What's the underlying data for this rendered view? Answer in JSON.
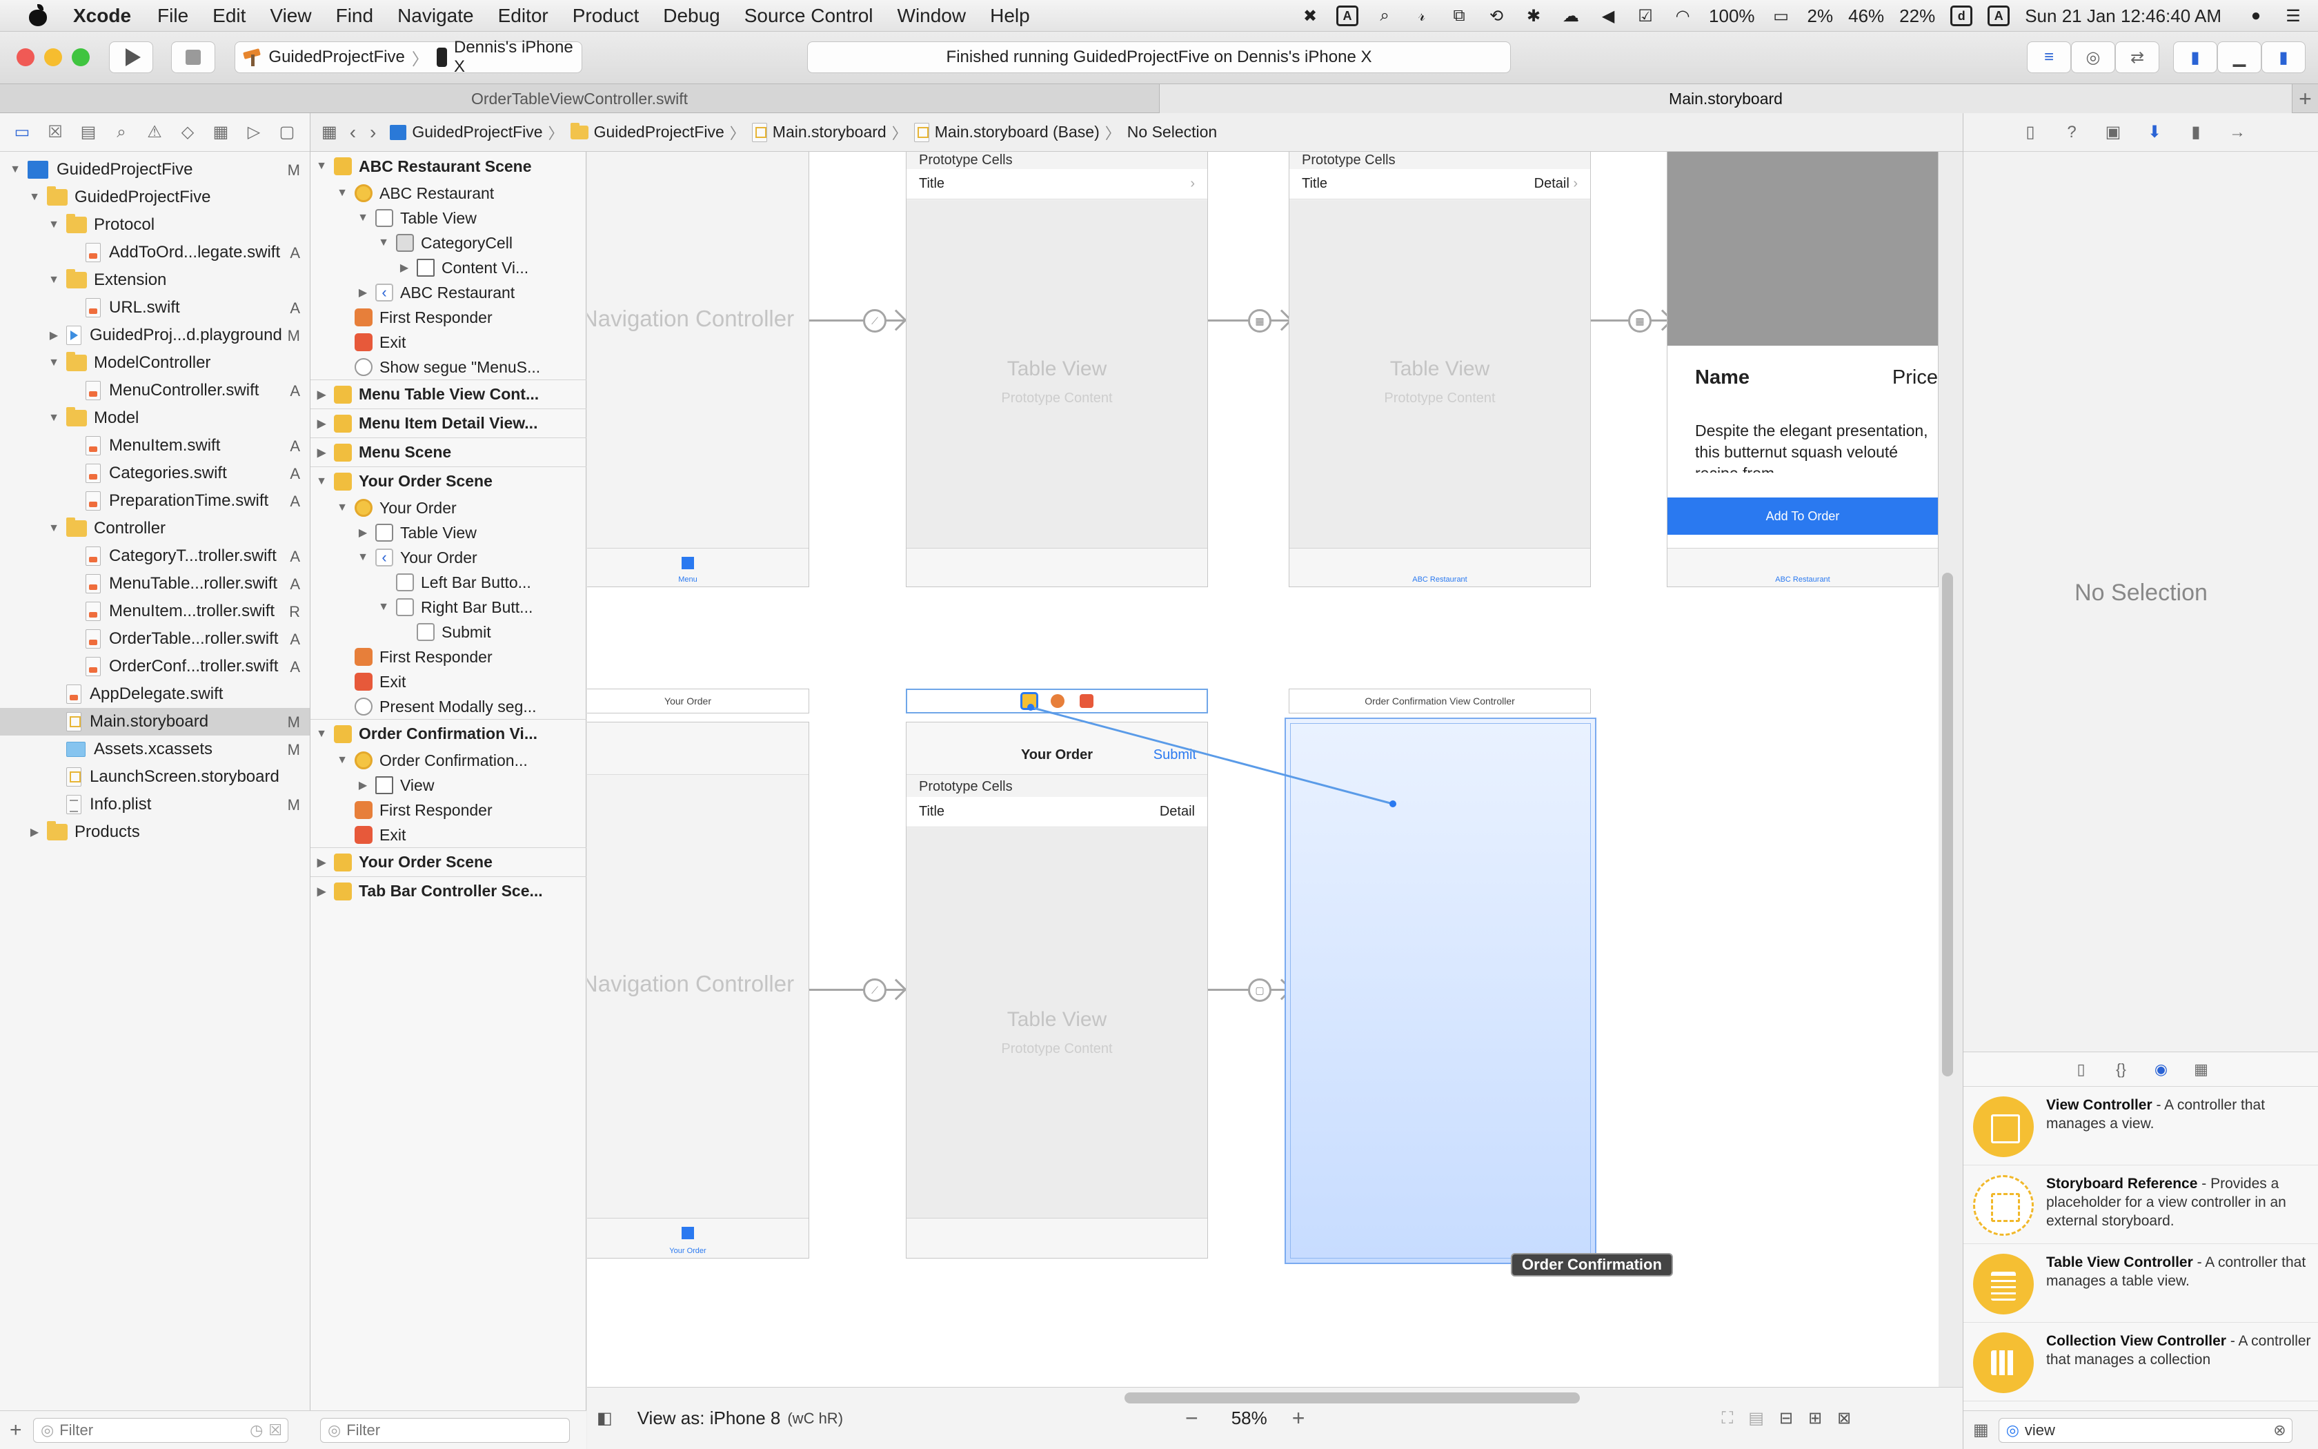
{
  "menubar": {
    "items": [
      "Xcode",
      "File",
      "Edit",
      "View",
      "Find",
      "Navigate",
      "Editor",
      "Product",
      "Debug",
      "Source Control",
      "Window",
      "Help"
    ],
    "status": {
      "battery1": "2%",
      "battery2": "46%",
      "battery3": "22%",
      "wifi_battery": "100%",
      "datetime": "Sun 21 Jan  12:46:40 AM",
      "mem_letter": "d",
      "input_letter": "A"
    }
  },
  "toolbar": {
    "scheme": "GuidedProjectFive",
    "device": "Dennis's iPhone X",
    "activity": "Finished running GuidedProjectFive on Dennis's iPhone X"
  },
  "tabs": [
    {
      "label": "OrderTableViewController.swift",
      "active": false
    },
    {
      "label": "Main.storyboard",
      "active": true
    }
  ],
  "navigator": {
    "items": [
      {
        "label": "GuidedProjectFive",
        "badge": "M",
        "indent": 0,
        "icon": "proj",
        "open": true
      },
      {
        "label": "GuidedProjectFive",
        "badge": "",
        "indent": 1,
        "icon": "folder",
        "open": true
      },
      {
        "label": "Protocol",
        "badge": "",
        "indent": 2,
        "icon": "folder",
        "open": true
      },
      {
        "label": "AddToOrd...legate.swift",
        "badge": "A",
        "indent": 3,
        "icon": "swift"
      },
      {
        "label": "Extension",
        "badge": "",
        "indent": 2,
        "icon": "folder",
        "open": true
      },
      {
        "label": "URL.swift",
        "badge": "A",
        "indent": 3,
        "icon": "swift"
      },
      {
        "label": "GuidedProj...d.playground",
        "badge": "M",
        "indent": 2,
        "icon": "play",
        "open": false
      },
      {
        "label": "ModelController",
        "badge": "",
        "indent": 2,
        "icon": "folder",
        "open": true
      },
      {
        "label": "MenuController.swift",
        "badge": "A",
        "indent": 3,
        "icon": "swift"
      },
      {
        "label": "Model",
        "badge": "",
        "indent": 2,
        "icon": "folder",
        "open": true
      },
      {
        "label": "MenuItem.swift",
        "badge": "A",
        "indent": 3,
        "icon": "swift"
      },
      {
        "label": "Categories.swift",
        "badge": "A",
        "indent": 3,
        "icon": "swift"
      },
      {
        "label": "PreparationTime.swift",
        "badge": "A",
        "indent": 3,
        "icon": "swift"
      },
      {
        "label": "Controller",
        "badge": "",
        "indent": 2,
        "icon": "folder",
        "open": true
      },
      {
        "label": "CategoryT...troller.swift",
        "badge": "A",
        "indent": 3,
        "icon": "swift"
      },
      {
        "label": "MenuTable...roller.swift",
        "badge": "A",
        "indent": 3,
        "icon": "swift"
      },
      {
        "label": "MenuItem...troller.swift",
        "badge": "R",
        "indent": 3,
        "icon": "swift"
      },
      {
        "label": "OrderTable...roller.swift",
        "badge": "A",
        "indent": 3,
        "icon": "swift"
      },
      {
        "label": "OrderConf...troller.swift",
        "badge": "A",
        "indent": 3,
        "icon": "swift"
      },
      {
        "label": "AppDelegate.swift",
        "badge": "",
        "indent": 2,
        "icon": "swift"
      },
      {
        "label": "Main.storyboard",
        "badge": "M",
        "indent": 2,
        "icon": "sb",
        "selected": true
      },
      {
        "label": "Assets.xcassets",
        "badge": "M",
        "indent": 2,
        "icon": "xcassets"
      },
      {
        "label": "LaunchScreen.storyboard",
        "badge": "",
        "indent": 2,
        "icon": "sb"
      },
      {
        "label": "Info.plist",
        "badge": "M",
        "indent": 2,
        "icon": "plist"
      },
      {
        "label": "Products",
        "badge": "",
        "indent": 1,
        "icon": "folder",
        "open": false
      }
    ],
    "filter_placeholder": "Filter"
  },
  "breadcrumb": [
    "GuidedProjectFive",
    "GuidedProjectFive",
    "Main.storyboard",
    "Main.storyboard (Base)",
    "No Selection"
  ],
  "outline": {
    "items": [
      {
        "label": "ABC Restaurant Scene",
        "indent": 0,
        "icon": "scene",
        "scene": true,
        "disc": "open"
      },
      {
        "label": "ABC Restaurant",
        "indent": 1,
        "icon": "vc",
        "disc": "open"
      },
      {
        "label": "Table View",
        "indent": 2,
        "icon": "tv",
        "disc": "open"
      },
      {
        "label": "CategoryCell",
        "indent": 3,
        "icon": "cell",
        "disc": "open"
      },
      {
        "label": "Content Vi...",
        "indent": 4,
        "icon": "view",
        "disc": "closed"
      },
      {
        "label": "ABC Restaurant",
        "indent": 2,
        "icon": "nav",
        "disc": "closed"
      },
      {
        "label": "First Responder",
        "indent": 1,
        "icon": "resp"
      },
      {
        "label": "Exit",
        "indent": 1,
        "icon": "exit"
      },
      {
        "label": "Show segue \"MenuS...",
        "indent": 1,
        "icon": "segue"
      },
      {
        "label": "Menu Table View Cont...",
        "indent": 0,
        "icon": "scene",
        "scene": true,
        "disc": "closed",
        "sep": true
      },
      {
        "label": "Menu Item Detail View...",
        "indent": 0,
        "icon": "scene",
        "scene": true,
        "disc": "closed",
        "sep": true
      },
      {
        "label": "Menu Scene",
        "indent": 0,
        "icon": "scene",
        "scene": true,
        "disc": "closed",
        "sep": true
      },
      {
        "label": "Your Order Scene",
        "indent": 0,
        "icon": "scene",
        "scene": true,
        "disc": "open",
        "sep": true
      },
      {
        "label": "Your Order",
        "indent": 1,
        "icon": "vc",
        "disc": "open"
      },
      {
        "label": "Table View",
        "indent": 2,
        "icon": "tv",
        "disc": "closed"
      },
      {
        "label": "Your Order",
        "indent": 2,
        "icon": "nav",
        "disc": "open"
      },
      {
        "label": "Left Bar Butto...",
        "indent": 3,
        "icon": "btn"
      },
      {
        "label": "Right Bar Butt...",
        "indent": 3,
        "icon": "btn",
        "disc": "open"
      },
      {
        "label": "Submit",
        "indent": 4,
        "icon": "btn"
      },
      {
        "label": "First Responder",
        "indent": 1,
        "icon": "resp"
      },
      {
        "label": "Exit",
        "indent": 1,
        "icon": "exit"
      },
      {
        "label": "Present Modally seg...",
        "indent": 1,
        "icon": "segue"
      },
      {
        "label": "Order Confirmation Vi...",
        "indent": 0,
        "icon": "scene",
        "scene": true,
        "disc": "open",
        "sep": true
      },
      {
        "label": "Order Confirmation...",
        "indent": 1,
        "icon": "vc",
        "disc": "open"
      },
      {
        "label": "View",
        "indent": 2,
        "icon": "view",
        "disc": "closed"
      },
      {
        "label": "First Responder",
        "indent": 1,
        "icon": "resp"
      },
      {
        "label": "Exit",
        "indent": 1,
        "icon": "exit"
      },
      {
        "label": "Your Order Scene",
        "indent": 0,
        "icon": "scene",
        "scene": true,
        "disc": "closed",
        "sep": true
      },
      {
        "label": "Tab Bar Controller Sce...",
        "indent": 0,
        "icon": "tab",
        "scene": true,
        "disc": "closed",
        "sep": true
      }
    ],
    "filter_placeholder": "Filter"
  },
  "canvas": {
    "nav_controller": "Navigation Controller",
    "table_view": "Table View",
    "prototype_content": "Prototype Content",
    "prototype_cells": "Prototype Cells",
    "cell_title": "Title",
    "cell_detail": "Detail",
    "tab_menu": "Menu",
    "tab_abc": "ABC Restaurant",
    "tab_your_order": "Your Order",
    "detail_name": "Name",
    "detail_price": "Price",
    "detail_desc": "Despite the elegant presentation, this butternut squash velouté recipe from",
    "add_to_order": "Add To Order",
    "your_order_header": "Your Order",
    "your_order_title": "Your Order",
    "submit": "Submit",
    "oc_header": "Order Confirmation View Controller",
    "oc_label": "Order Confirmation"
  },
  "editor_bottom": {
    "view_as": "View as: iPhone 8",
    "size_class": "(wC hR)",
    "zoom": "58%"
  },
  "inspector": {
    "no_selection": "No Selection"
  },
  "library": {
    "items": [
      {
        "name": "View Controller",
        "desc": " - A controller that manages a view.",
        "icon": "solid"
      },
      {
        "name": "Storyboard Reference",
        "desc": " - Provides a placeholder for a view controller in an external storyboard.",
        "icon": "dashed"
      },
      {
        "name": "Table View Controller",
        "desc": " - A controller that manages a table view.",
        "icon": "lines"
      },
      {
        "name": "Collection View Controller",
        "desc": " - A controller that manages a collection",
        "icon": "grid"
      }
    ],
    "filter_value": "view"
  }
}
